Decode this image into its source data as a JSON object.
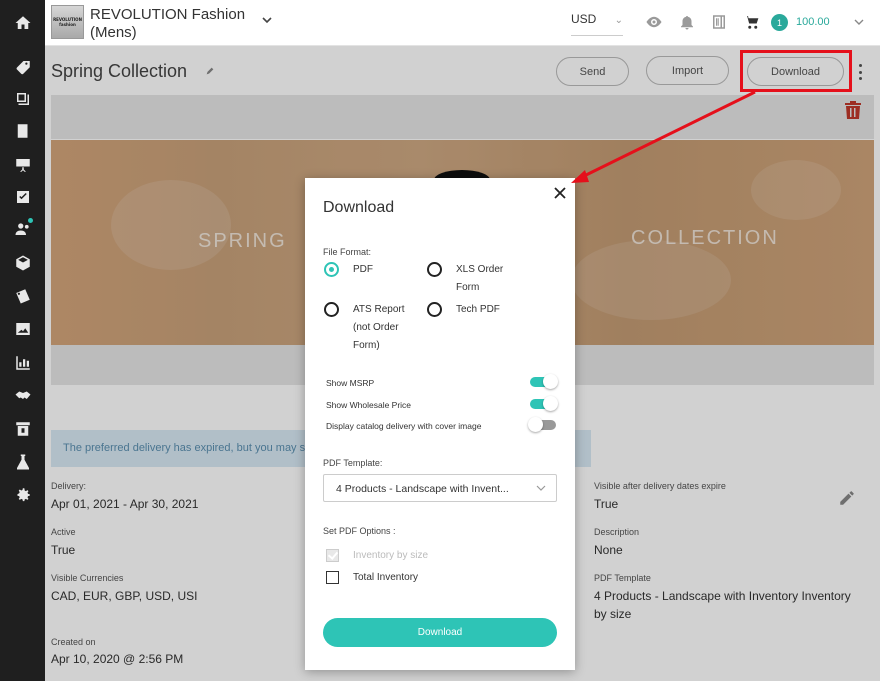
{
  "header": {
    "logo_line1": "REVOLUTION",
    "logo_line2": "fashion",
    "brand": "REVOLUTION Fashion (Mens)",
    "currency": "USD",
    "cart_count": "1",
    "cart_total": "100.00"
  },
  "sidebar": {
    "icons": [
      "home-icon",
      "tag-icon",
      "catalog-icon",
      "book-icon",
      "presentation-icon",
      "checklist-icon",
      "users-icon",
      "box-icon",
      "discount-icon",
      "image-icon",
      "bar-chart-icon",
      "handshake-icon",
      "kiosk-icon",
      "flask-icon",
      "settings-icon"
    ]
  },
  "page": {
    "title": "Spring Collection",
    "send_label": "Send",
    "import_label": "Import",
    "download_label": "Download",
    "cover_left": "SPRING",
    "cover_right": "COLLECTION",
    "alert": "The preferred delivery has expired, but you may stil",
    "fields": {
      "delivery_label": "Delivery:",
      "delivery_value": "Apr 01, 2021 - Apr 30, 2021",
      "active_label": "Active",
      "active_value": "True",
      "currencies_label": "Visible Currencies",
      "currencies_value": "CAD, EUR, GBP, USD, USI",
      "created_label": "Created on",
      "created_value": "Apr 10, 2020 @ 2:56 PM",
      "visible_after_label": "Visible after delivery dates expire",
      "visible_after_value": "True",
      "description_label": "Description",
      "description_value": "None",
      "pdf_template_label": "PDF Template",
      "pdf_template_value": "4 Products - Landscape with Inventory Inventory by size"
    }
  },
  "modal": {
    "title": "Download",
    "file_format_label": "File Format:",
    "formats": [
      {
        "label": "PDF",
        "checked": true
      },
      {
        "label": "XLS Order Form",
        "checked": false
      },
      {
        "label": "ATS Report (not Order Form)",
        "checked": false
      },
      {
        "label": "Tech PDF",
        "checked": false
      }
    ],
    "toggles": [
      {
        "label": "Show MSRP",
        "on": true
      },
      {
        "label": "Show Wholesale Price",
        "on": true
      },
      {
        "label": "Display catalog delivery with cover image",
        "on": false
      }
    ],
    "pdf_template_label": "PDF Template:",
    "pdf_template_value": "4 Products - Landscape with Invent...",
    "options_label": "Set PDF Options :",
    "options": [
      {
        "label": "Inventory by size",
        "checked": true,
        "disabled": true
      },
      {
        "label": "Total Inventory",
        "checked": false,
        "disabled": false
      }
    ],
    "download_button": "Download"
  },
  "colors": {
    "accent": "#2ec4b6",
    "sidebar": "#1f1f1f",
    "annotation": "#e5101b"
  }
}
